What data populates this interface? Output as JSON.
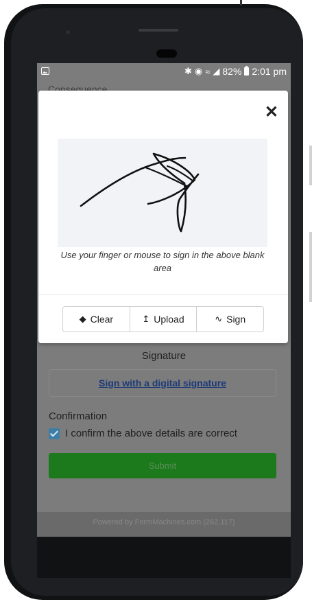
{
  "status_bar": {
    "icons": [
      "gallery-icon",
      "bluetooth-icon",
      "alarm-icon",
      "wifi-icon",
      "signal-icon",
      "battery-icon"
    ],
    "battery_percent": "82%",
    "time": "2:01 pm"
  },
  "background_form": {
    "section_label": "Consequence",
    "signature_label": "Signature",
    "signature_link": "Sign with a digital signature",
    "confirmation_label": "Confirmation",
    "confirm_checkbox": {
      "label": "I confirm the above details are correct",
      "checked": true
    },
    "submit_label": "Submit",
    "footer": "Powered by FormMachines.com (262,117)"
  },
  "signature_modal": {
    "hint": "Use your finger or mouse to sign in the above blank area",
    "buttons": [
      {
        "label": "Clear",
        "icon": "eraser-icon"
      },
      {
        "label": "Upload",
        "icon": "upload-icon"
      },
      {
        "label": "Sign",
        "icon": "signature-icon"
      }
    ]
  },
  "colors": {
    "submit_green": "#1c7a1c",
    "link_blue": "#1d3a78",
    "checkbox_blue": "#3d7ea6",
    "overlay_gray": "#7c7c7c",
    "canvas_bg": "#f1f3f7"
  }
}
